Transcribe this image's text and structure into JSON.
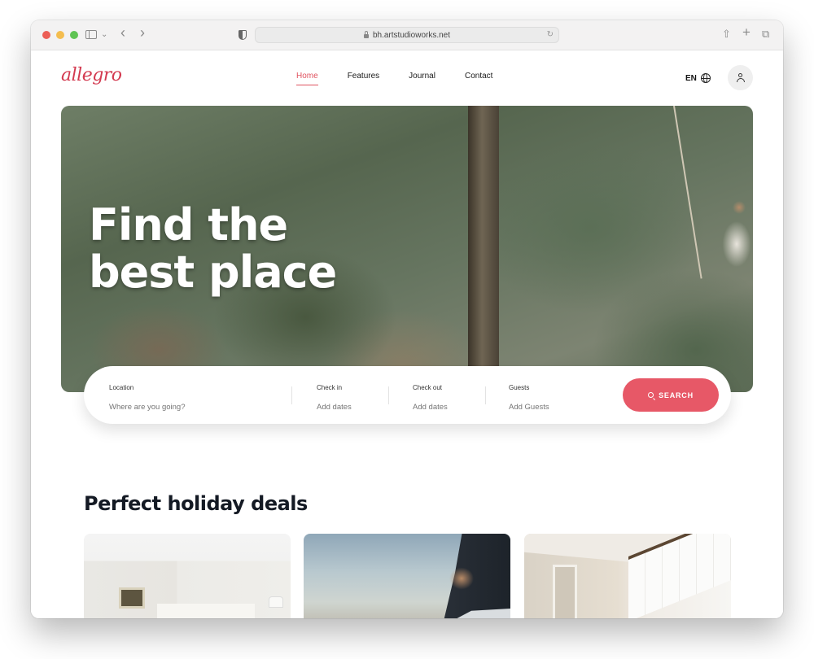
{
  "browser": {
    "url": "bh.artstudioworks.net",
    "icons": {
      "traffic_lights": [
        "close",
        "minimize",
        "maximize"
      ],
      "left": [
        "sidebar-toggle-icon",
        "chevron-down-icon",
        "back-icon",
        "forward-icon",
        "privacy-shield-icon"
      ],
      "right": [
        "share-icon",
        "new-tab-icon",
        "tabs-overview-icon"
      ],
      "address": [
        "lock-icon",
        "reload-icon"
      ]
    },
    "back_glyph": "‹",
    "forward_glyph": "›",
    "chevron_glyph": "⌄",
    "reload_glyph": "↻",
    "share_glyph": "⇧",
    "plus_glyph": "+",
    "tabs_glyph": "⧉"
  },
  "header": {
    "logo": "allegro",
    "nav": [
      {
        "label": "Home",
        "active": true
      },
      {
        "label": "Features",
        "active": false
      },
      {
        "label": "Journal",
        "active": false
      },
      {
        "label": "Contact",
        "active": false
      }
    ],
    "language": "EN",
    "icons": [
      "globe-icon",
      "user-icon"
    ]
  },
  "hero": {
    "title": "Find the best place"
  },
  "search": {
    "location": {
      "label": "Location",
      "placeholder": "Where are you going?"
    },
    "check_in": {
      "label": "Check in",
      "placeholder": "Add dates"
    },
    "check_out": {
      "label": "Check out",
      "placeholder": "Add dates"
    },
    "guests": {
      "label": "Guests",
      "placeholder": "Add Guests"
    },
    "button_label": "SEARCH"
  },
  "deals": {
    "title": "Perfect holiday deals",
    "cards": [
      {
        "image": "bright bedroom with framed painting and lamps"
      },
      {
        "image": "modern building with palm trees by the sea"
      },
      {
        "image": "hotel room with large upholstered headboard"
      }
    ]
  },
  "colors": {
    "accent": "#e75867",
    "logo": "#d33a50",
    "heading": "#141a24"
  }
}
